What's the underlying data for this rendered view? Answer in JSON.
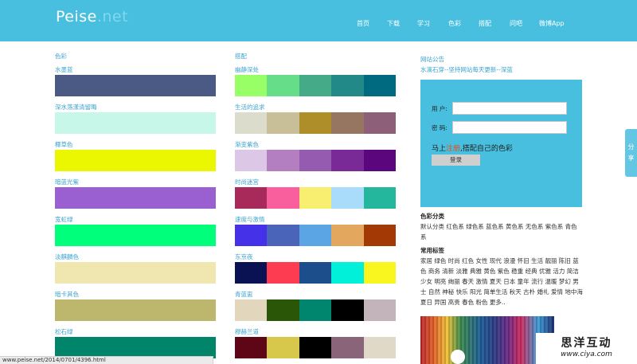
{
  "brand": {
    "name": "Peise",
    "suffix": ".net"
  },
  "nav": [
    "首页",
    "下载",
    "学习",
    "色彩",
    "搭配",
    "问吧",
    "微博App"
  ],
  "colors": {
    "section_title": "色彩",
    "items": [
      {
        "name": "水墨蓝",
        "color": "#4a5a85"
      },
      {
        "name": "深水荡漾清留晦",
        "color": "#c7f7e8"
      },
      {
        "name": "椰草色",
        "color": "#eaf700"
      },
      {
        "name": "暗蓝光紫",
        "color": "#9a5fd0"
      },
      {
        "name": "宽虹绿",
        "color": "#00ff7a"
      },
      {
        "name": "淡麒麟色",
        "color": "#efe6b0"
      },
      {
        "name": "暗卡其色",
        "color": "#bdb66d"
      },
      {
        "name": "松石绿",
        "color": "#00856a"
      }
    ]
  },
  "palettes": {
    "section_title": "搭配",
    "items": [
      {
        "name": "幽静深处",
        "colors": [
          "#99ff66",
          "#66dd88",
          "#44aa88",
          "#228888",
          "#006b80"
        ]
      },
      {
        "name": "生活的追求",
        "colors": [
          "#dcdccc",
          "#c8bf98",
          "#ae8e28",
          "#967661",
          "#8d5f78"
        ]
      },
      {
        "name": "渐变紫色",
        "colors": [
          "#dcc7e6",
          "#b47fc1",
          "#955bb0",
          "#7a2a96",
          "#5c067d"
        ]
      },
      {
        "name": "时尚迷宫",
        "colors": [
          "#a72a5a",
          "#fa5f9d",
          "#f8ef70",
          "#a9dcfb",
          "#25b79e"
        ]
      },
      {
        "name": "速度与激情",
        "colors": [
          "#4431e8",
          "#4a64ba",
          "#5ba5e5",
          "#e3a85e",
          "#a33a05"
        ]
      },
      {
        "name": "东京夜",
        "colors": [
          "#0b1254",
          "#fd3c52",
          "#1c4e8b",
          "#00f0d9",
          "#f9f61f"
        ]
      },
      {
        "name": "青蓝崽",
        "colors": [
          "#e2d6bd",
          "#295707",
          "#00866f",
          "#000000",
          "#c2b4ba"
        ]
      },
      {
        "name": "穆赫兰道",
        "colors": [
          "#5e0615",
          "#d7c74b",
          "#000000",
          "#8a6479",
          "#e0d9c8"
        ]
      }
    ]
  },
  "notice": {
    "title": "网站公告",
    "text": "水滴石穿--坚持网站每天更新--深蓝"
  },
  "login": {
    "user_label": "用 户:",
    "password_label": "密 码:",
    "register_prefix": "马上",
    "register_link": "注册",
    "register_suffix": ",搭配自己的色彩",
    "button": "登录"
  },
  "categories": {
    "title": "色彩分类",
    "text": "默认分类 红色系 绿色系 蓝色系 黄色系 无色系 紫色系 青色系"
  },
  "tags": {
    "title": "常用标签",
    "text": "家居 绿色 时尚 红色 女性 现代 浪漫 怀旧 生活 靓丽 陈旧 蓝色 商务 清新 淡雅 典雅 黄色 紫色 稳重 经典 优雅 活力 简洁 少女 明亮 绚丽 春天 激情 夏天 日本 童年 流行 温暖 梦幻 男士 自然 神秘 快乐 阳光 简单生活 秋天 古朴 婚礼 爱情 地中海 夏日 异国 高贵 春色 粉色 更多.."
  },
  "share_tab": "分享",
  "status_bar": "www.peise.net/2014/0701/4396.html",
  "watermark": {
    "title": "思洋互动",
    "url": "www.ciya.com"
  }
}
